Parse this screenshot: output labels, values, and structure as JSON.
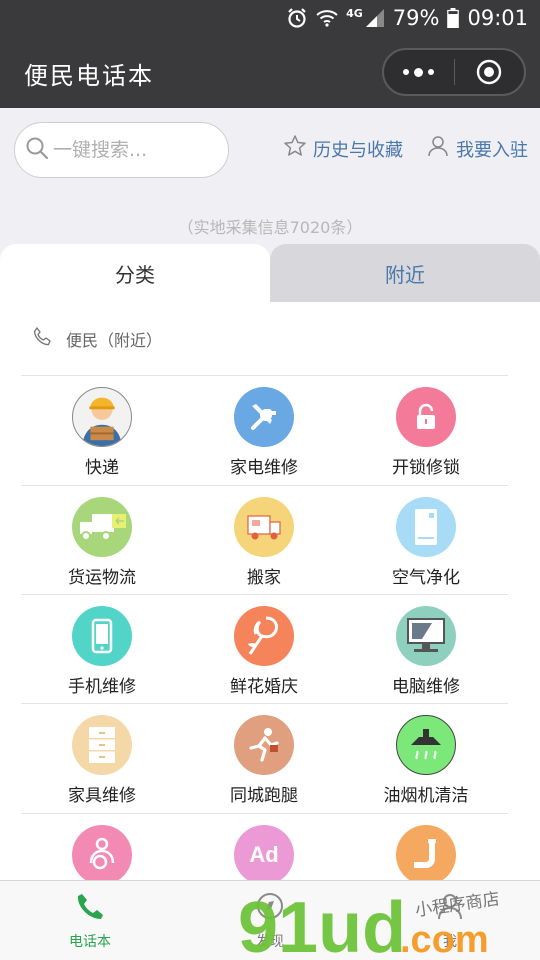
{
  "status_bar": {
    "network": "4G",
    "battery": "79%",
    "time": "09:01",
    "icons": [
      "alarm-icon",
      "wifi-icon",
      "signal-icon",
      "battery-icon"
    ]
  },
  "nav": {
    "title": "便民电话本",
    "more_icon": "more-dots-icon",
    "close_icon": "close-circle-icon"
  },
  "search": {
    "placeholder": "一键搜索...",
    "value": ""
  },
  "links": {
    "history": "历史与收藏",
    "join": "我要入驻"
  },
  "info_count": "（实地采集信息7020条）",
  "tabs": {
    "category": "分类",
    "nearby": "附近"
  },
  "section": {
    "title": "便民（附近）"
  },
  "categories": [
    {
      "label": "快递",
      "icon": "courier-icon",
      "color": "#f1f1f1"
    },
    {
      "label": "家电维修",
      "icon": "tools-icon",
      "color": "#6aa8e4"
    },
    {
      "label": "开锁修锁",
      "icon": "unlock-icon",
      "color": "#f47a9a"
    },
    {
      "label": "货运物流",
      "icon": "truck-icon",
      "color": "#a8d67a"
    },
    {
      "label": "搬家",
      "icon": "moving-truck-icon",
      "color": "#f6d479"
    },
    {
      "label": "空气净化",
      "icon": "air-purifier-icon",
      "color": "#a8dcf6"
    },
    {
      "label": "手机维修",
      "icon": "phone-icon",
      "color": "#52d4c8"
    },
    {
      "label": "鲜花婚庆",
      "icon": "rose-icon",
      "color": "#f5845a"
    },
    {
      "label": "电脑维修",
      "icon": "monitor-icon",
      "color": "#8ed0be"
    },
    {
      "label": "家具维修",
      "icon": "cabinet-icon",
      "color": "#f4d8a8"
    },
    {
      "label": "同城跑腿",
      "icon": "runner-icon",
      "color": "#e0a080"
    },
    {
      "label": "油烟机清洁",
      "icon": "range-hood-icon",
      "color": "#7de87a"
    },
    {
      "label": "",
      "icon": "mother-baby-icon",
      "color": "#f28ab4"
    },
    {
      "label": "",
      "icon": "ad-icon",
      "color": "#ec9ad6",
      "text": "Ad"
    },
    {
      "label": "",
      "icon": "pipe-icon",
      "color": "#f5a860"
    }
  ],
  "tab_bar": {
    "phonebook": "电话本",
    "discover": "发现",
    "me": "我"
  },
  "watermark": {
    "brand": "91ud",
    "suffix": ".com",
    "sub": "小程序商店"
  },
  "colors": {
    "nav_bg": "#3a3a3c",
    "link": "#4a78a8",
    "active_green": "#2aa44f"
  }
}
